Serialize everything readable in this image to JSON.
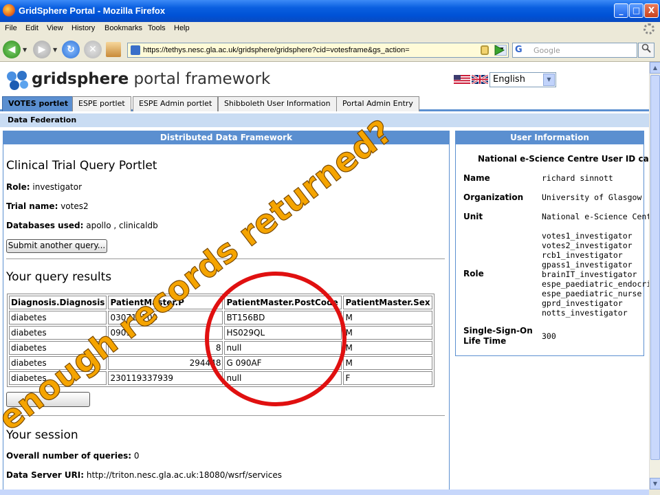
{
  "window": {
    "title": "GridSphere Portal - Mozilla Firefox",
    "minimize": "_",
    "maximize": "□",
    "close": "X"
  },
  "menu": [
    "File",
    "Edit",
    "View",
    "History",
    "Bookmarks",
    "Tools",
    "Help"
  ],
  "address_bar": {
    "url": "https://tethys.nesc.gla.ac.uk/gridsphere/gridsphere?cid=votesframe&gs_action="
  },
  "search": {
    "placeholder": "Google",
    "engine_icon": "G"
  },
  "portal": {
    "brand_bold": "gridsphere",
    "brand_rest": " portal framework",
    "language": "English",
    "tabs": [
      "VOTES portlet",
      "ESPE portlet",
      "ESPE Admin portlet",
      "Shibboleth User Information",
      "Portal Admin Entry"
    ],
    "subnav": "Data Federation"
  },
  "query_panel": {
    "header": "Distributed Data Framework",
    "title": "Clinical Trial Query Portlet",
    "role_label": "Role:",
    "role_value": "investigator",
    "trial_label": "Trial name:",
    "trial_value": "votes2",
    "db_label": "Databases used:",
    "db_value": "apollo , clinicaldb",
    "submit_button": "Submit another query...",
    "results_title": "Your query results",
    "columns": [
      "Diagnosis.Diagnosis",
      "PatientMaster.P",
      "PatientMaster.PostCode",
      "PatientMaster.Sex"
    ],
    "rows": [
      [
        "diabetes",
        "030719703",
        "BT156BD",
        "M"
      ],
      [
        "diabetes",
        "0909",
        "HS029QL",
        "M"
      ],
      [
        "diabetes",
        "8",
        "null",
        "M"
      ],
      [
        "diabetes",
        "294448",
        "G 090AF",
        "M"
      ],
      [
        "diabetes",
        "230119337939",
        "null",
        "F"
      ]
    ],
    "session_title": "Your session",
    "queries_label": "Overall number of queries:",
    "queries_value": "0",
    "uri_label": "Data Server URI:",
    "uri_value": "http://triton.nesc.gla.ac.uk:18080/wsrf/services"
  },
  "user_panel": {
    "header": "User Information",
    "subtitle": "National e-Science Centre User ID ca",
    "name_label": "Name",
    "name_value": "richard sinnott",
    "org_label": "Organization",
    "org_value": "University of Glasgow",
    "unit_label": "Unit",
    "unit_value": "National e-Science Cent",
    "role_label": "Role",
    "roles": [
      "votes1_investigator",
      "votes2_investigator",
      "rcb1_investigator",
      "gpass1_investigator",
      "brainIT_investigator",
      "espe_paediatric_endocrin",
      "espe_paediatric_nurse",
      "gprd_investigator",
      "notts_investigator"
    ],
    "sso_label_1": "Single-Sign-On",
    "sso_label_2": "Life Time",
    "sso_value": "300"
  },
  "annotation": {
    "text": "enough records returned?",
    "color": "#f5a400",
    "circle_color": "#e01010"
  }
}
